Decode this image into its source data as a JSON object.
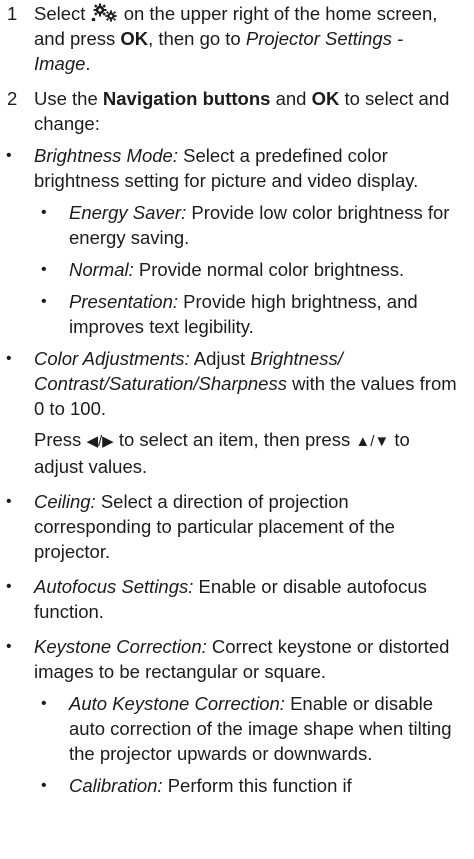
{
  "step1": {
    "number": "1",
    "before_icon": "Select",
    "icon": "settings-gears-icon",
    "after_icon": "on the upper right of the home screen, and press",
    "ok": "OK",
    "then": ", then go to",
    "path": "Projector Settings - Image",
    "end": "."
  },
  "step2": {
    "number": "2",
    "use": "Use the",
    "nav": "Navigation buttons",
    "and": "and",
    "ok": "OK",
    "rest": "to select and change:"
  },
  "brightness": {
    "term": "Brightness Mode:",
    "desc": "Select a predefined color brightness setting for picture and video display.",
    "options": [
      {
        "term": "Energy Saver:",
        "desc": "Provide low color brightness for energy saving."
      },
      {
        "term": "Normal:",
        "desc": "Provide normal color brightness."
      },
      {
        "term": "Presentation:",
        "desc": "Provide high brightness, and improves text legibility."
      }
    ]
  },
  "color": {
    "term": "Color Adjustments:",
    "adjust": "Adjust",
    "params": "Brightness/ Contrast/Saturation/Sharpness",
    "range": "with the values from 0 to 100.",
    "press": "Press",
    "lr": "◀/▶",
    "select_item": "to select an item, then press",
    "ud": "▲/▼",
    "adjust_values": "to adjust values."
  },
  "ceiling": {
    "term": "Ceiling:",
    "desc": "Select a direction of projection corresponding to particular placement of the projector."
  },
  "autofocus": {
    "term": "Autofocus Settings:",
    "desc": "Enable or disable autofocus function."
  },
  "keystone": {
    "term": "Keystone Correction:",
    "desc": "Correct keystone or distorted images to be rectangular or square.",
    "options": [
      {
        "term": "Auto Keystone Correction:",
        "desc": "Enable or disable auto correction of the image shape when tilting the projector upwards or downwards."
      },
      {
        "term": "Calibration:",
        "desc": "Perform this function if"
      }
    ]
  },
  "bullet": "•"
}
